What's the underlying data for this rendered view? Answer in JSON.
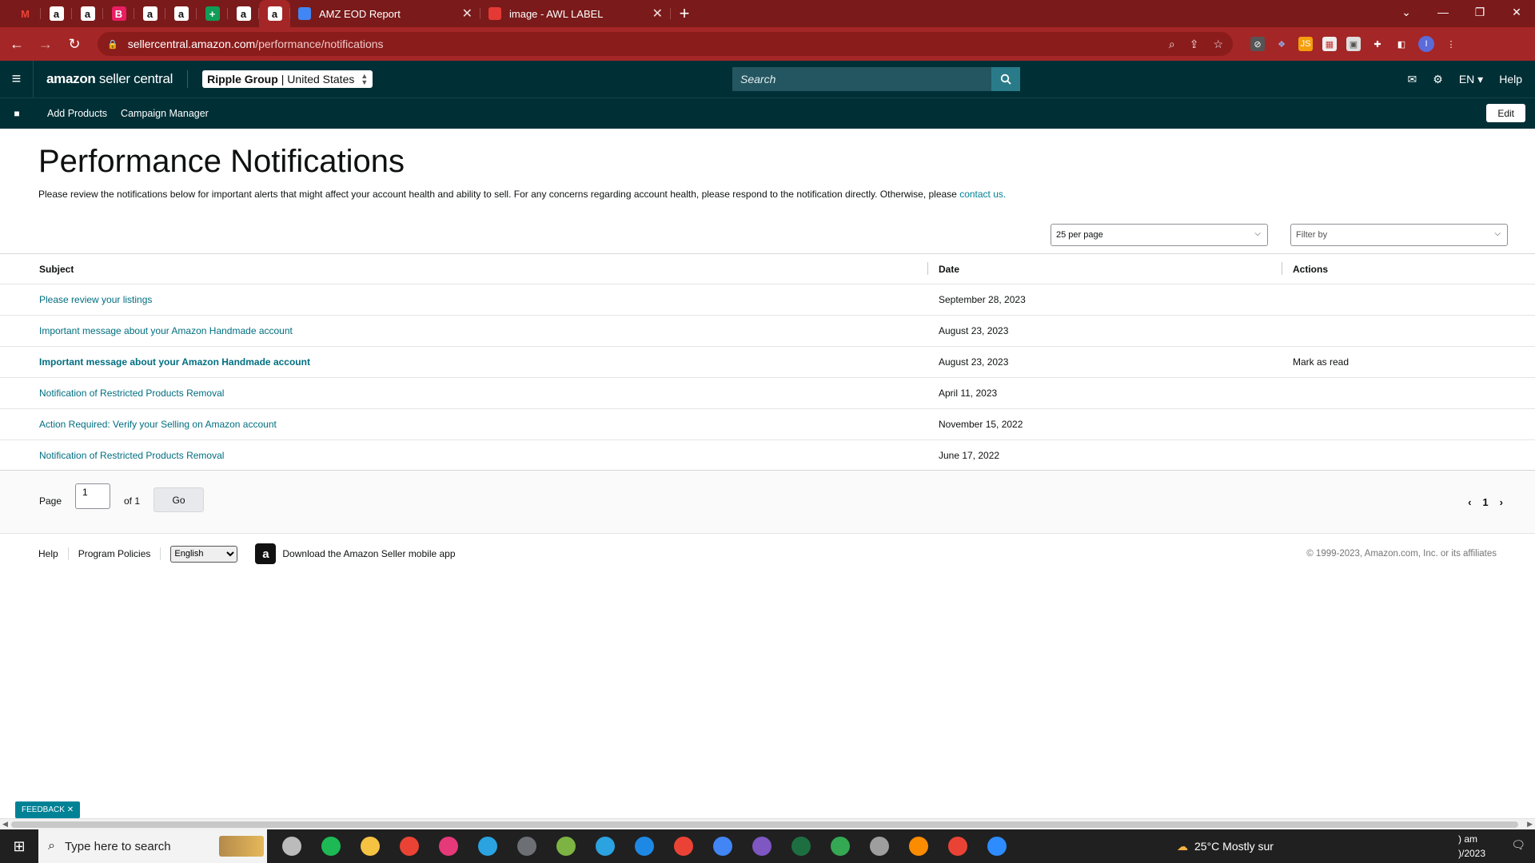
{
  "browser": {
    "pinned_tabs": [
      {
        "glyph": "M",
        "color": "#ea4335",
        "bg": "transparent"
      },
      {
        "glyph": "a",
        "color": "#111111",
        "bg": "#ffffff"
      },
      {
        "glyph": "a",
        "color": "#111111",
        "bg": "#ffffff"
      },
      {
        "glyph": "B",
        "color": "#ffffff",
        "bg": "#e91e63"
      },
      {
        "glyph": "a",
        "color": "#111111",
        "bg": "#ffffff"
      },
      {
        "glyph": "a",
        "color": "#111111",
        "bg": "#ffffff"
      },
      {
        "glyph": "+",
        "color": "#ffffff",
        "bg": "#0f9d58"
      },
      {
        "glyph": "a",
        "color": "#111111",
        "bg": "#ffffff"
      },
      {
        "glyph": "a",
        "color": "#111111",
        "bg": "#ffffff"
      }
    ],
    "tabs": [
      {
        "title": "AMZ EOD Report",
        "fav_color": "#4285f4"
      },
      {
        "title": "image - AWL LABEL",
        "fav_color": "#e53935"
      }
    ],
    "url_host": "sellercentral.amazon.com",
    "url_path": "/performance/notifications",
    "profile_initial": "I"
  },
  "header": {
    "logo_bold": "amazon",
    "logo_thin": " seller central",
    "account_name": "Ripple Group",
    "account_region": "| United States",
    "search_placeholder": "Search",
    "language": "EN",
    "help": "Help"
  },
  "nav": {
    "links": [
      "Add Products",
      "Campaign Manager"
    ],
    "edit": "Edit"
  },
  "page": {
    "title": "Performance Notifications",
    "intro": "Please review the notifications below for important alerts that might affect your account health and ability to sell. For any concerns regarding account health, please respond to the notification directly. Otherwise, please ",
    "intro_link": "contact us."
  },
  "controls": {
    "per_page": "25 per page",
    "filter": "Filter by"
  },
  "table": {
    "headers": [
      "Subject",
      "Date",
      "Actions"
    ],
    "rows": [
      {
        "subject": "Please review your listings",
        "date": "September 28, 2023",
        "action": "",
        "unread": false
      },
      {
        "subject": "Important message about your Amazon Handmade account",
        "date": "August 23, 2023",
        "action": "",
        "unread": false
      },
      {
        "subject": "Important message about your Amazon Handmade account",
        "date": "August 23, 2023",
        "action": "Mark as read",
        "unread": true
      },
      {
        "subject": "Notification of Restricted Products Removal",
        "date": "April 11, 2023",
        "action": "",
        "unread": false
      },
      {
        "subject": "Action Required: Verify your Selling on Amazon account",
        "date": "November 15, 2022",
        "action": "",
        "unread": false
      },
      {
        "subject": "Notification of Restricted Products Removal",
        "date": "June 17, 2022",
        "action": "",
        "unread": false
      }
    ]
  },
  "pager": {
    "page_label": "Page",
    "page_value": "1",
    "of_label": "of 1",
    "go": "Go",
    "current": "1"
  },
  "footer": {
    "help": "Help",
    "policies": "Program Policies",
    "language_option": "English",
    "app_text": "Download the Amazon Seller mobile app",
    "copyright": "© 1999-2023, Amazon.com, Inc. or its affiliates"
  },
  "feedback": "FEEDBACK",
  "taskbar": {
    "search_placeholder": "Type here to search",
    "weather": "25°C  Mostly sur",
    "clock_time": ") am",
    "clock_date": ")/2023",
    "app_colors": [
      "#bbbbbb",
      "#1db954",
      "#f5c242",
      "#ea4335",
      "#e53979",
      "#2aa3e0",
      "#6c6f73",
      "#7cb342",
      "#2aa3e0",
      "#1e88e5",
      "#ea4335",
      "#4285f4",
      "#7e57c2",
      "#1d6f42",
      "#34a853",
      "#9e9e9e",
      "#fb8c00",
      "#ea4335",
      "#2d8cff"
    ]
  }
}
